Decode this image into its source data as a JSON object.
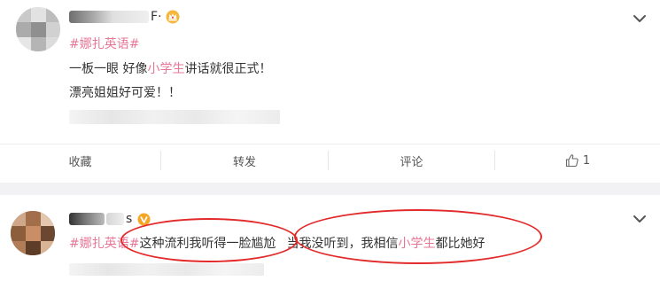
{
  "post": {
    "author_suffix": "F·",
    "topic": "#娜扎英语#",
    "line1_before": "一板一眼 好像",
    "line1_highlight": "小学生",
    "line1_after": "讲话就很正式！",
    "line2": "漂亮姐姐好可爱！！"
  },
  "actions": {
    "collect": "收藏",
    "repost": "转发",
    "comment": "评论",
    "like_count": "1"
  },
  "reply": {
    "author_suffix": "s",
    "topic": "#娜扎英语#",
    "text_part1": "这种流利我听得一脸尴尬",
    "text_part2_before": "当我没听到，我相信",
    "text_part2_highlight": "小学生",
    "text_part2_after": "都比她好"
  },
  "colors": {
    "topic": "#e87697",
    "annotation": "#e32a2a",
    "vip_badge": "#f5a623"
  },
  "icons": [
    "crown-icon",
    "chevron-down-icon",
    "thumbs-up-icon",
    "verified-badge-icon"
  ]
}
